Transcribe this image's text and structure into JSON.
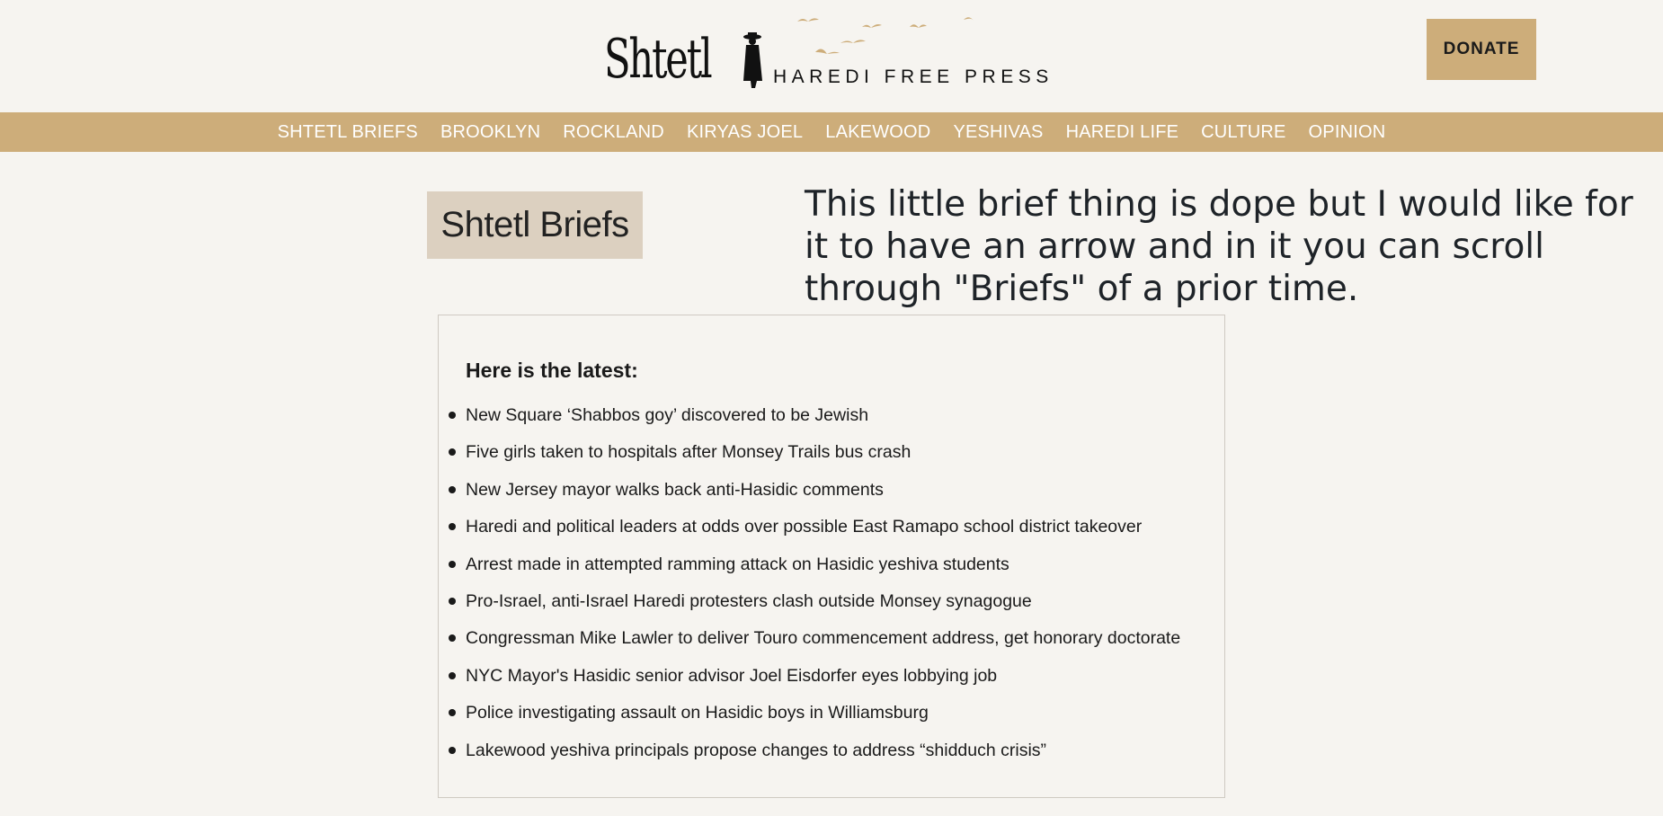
{
  "header": {
    "logo_word": "Shtetl",
    "logo_tagline": "HAREDI FREE PRESS",
    "donate_label": "DONATE"
  },
  "nav": {
    "items": [
      "SHTETL BRIEFS",
      "BROOKLYN",
      "ROCKLAND",
      "KIRYAS JOEL",
      "LAKEWOOD",
      "YESHIVAS",
      "HAREDI LIFE",
      "CULTURE",
      "OPINION"
    ]
  },
  "section": {
    "label": "Shtetl Briefs"
  },
  "comment": "This little brief thing is dope but I would like for it to have an arrow and in it you can scroll through \"Briefs\" of a prior time.",
  "briefs": {
    "heading": "Here is the latest:",
    "items": [
      "New Square ‘Shabbos goy’ discovered to be Jewish",
      "Five girls taken to hospitals after Monsey Trails bus crash",
      "New Jersey mayor walks back anti-Hasidic comments",
      "Haredi and political leaders at odds over possible East Ramapo school district takeover",
      "Arrest made in attempted ramming attack on Hasidic yeshiva students",
      "Pro-Israel, anti-Israel Haredi protesters clash outside Monsey synagogue",
      "Congressman Mike Lawler to deliver Touro commencement address, get honorary doctorate",
      "NYC Mayor's Hasidic senior advisor Joel Eisdorfer eyes lobbying job",
      "Police investigating assault on Hasidic boys in Williamsburg",
      "Lakewood yeshiva principals propose changes to address “shidduch crisis”"
    ]
  },
  "colors": {
    "background": "#f6f4f0",
    "accent_gold": "#cdad7a",
    "label_bg": "#dcd0c0",
    "text": "#1a1a1a"
  }
}
